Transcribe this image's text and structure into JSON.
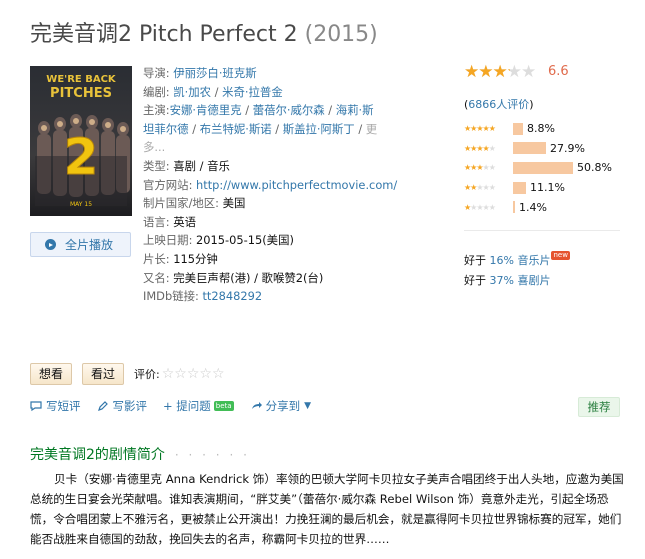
{
  "movie": {
    "title": "完美音调2 Pitch Perfect 2",
    "year": "(2015)"
  },
  "poster": {
    "tagline": "WE'RE BACK PITCHES",
    "number": "2",
    "date": "MAY 15"
  },
  "play_button_label": "全片播放",
  "info": {
    "director_label": "导演:",
    "director": "伊丽莎白·班克斯",
    "writers_label": "编剧:",
    "writer1": "凯·加农",
    "writer2": "米奇·拉普金",
    "cast_label": "主演:",
    "cast": [
      "安娜·肯德里克",
      "蕾蓓尔·威尔森",
      "海莉·斯坦菲尔德",
      "布兰特妮·斯诺",
      "斯盖拉·阿斯丁"
    ],
    "more": "更多...",
    "genre_label": "类型:",
    "genre": "喜剧 / 音乐",
    "site_label": "官方网站:",
    "site": "http://www.pitchperfectmovie.com/",
    "country_label": "制片国家/地区:",
    "country": "美国",
    "language_label": "语言:",
    "language": "英语",
    "release_label": "上映日期:",
    "release": "2015-05-15(美国)",
    "runtime_label": "片长:",
    "runtime": "115分钟",
    "aka_label": "又名:",
    "aka": "完美巨声帮(港) / 歌喉赞2(台)",
    "imdb_label": "IMDb链接:",
    "imdb": "tt2848292"
  },
  "rating": {
    "score": "6.6",
    "stars_fill": 0.65,
    "votes_prefix": "(",
    "votes_link": "6866人评价",
    "votes_suffix": ")",
    "breakdown": [
      {
        "stars": 5,
        "percent": 8.8,
        "label": "8.8%"
      },
      {
        "stars": 4,
        "percent": 27.9,
        "label": "27.9%"
      },
      {
        "stars": 3,
        "percent": 50.8,
        "label": "50.8%"
      },
      {
        "stars": 2,
        "percent": 11.1,
        "label": "11.1%"
      },
      {
        "stars": 1,
        "percent": 1.4,
        "label": "1.4%"
      }
    ],
    "colors": {
      "star": "#f5a623",
      "bar": "#f7c8a0",
      "score": "#e06b4c"
    }
  },
  "better_than": [
    {
      "prefix": "好于 ",
      "link": "16% 音乐片",
      "badge": "new"
    },
    {
      "prefix": "好于 ",
      "link": "37% 喜剧片"
    }
  ],
  "actions": {
    "want": "想看",
    "seen": "看过",
    "rate_label": "评价:"
  },
  "toolbar": {
    "short_review": "写短评",
    "review": "写影评",
    "ask": "+ 提问题",
    "beta": "beta",
    "share": "分享到",
    "recommend": "推荐"
  },
  "synopsis": {
    "title": "完美音调2的剧情简介",
    "dots": "· · · · · ·",
    "text": "贝卡（安娜·肯德里克 Anna Kendrick 饰）率领的巴顿大学阿卡贝拉女子美声合唱团终于出人头地，应邀为美国总统的生日宴会光荣献唱。谁知表演期间，“胖艾美”（蕾蓓尔·威尔森 Rebel Wilson 饰）竟意外走光，引起全场恐慌，令合唱团蒙上不雅污名，更被禁止公开演出！力挽狂澜的最后机会，就是赢得阿卡贝拉世界锦标赛的冠军，她们能否战胜来自德国的劲敌，挽回失去的名声，称霸阿卡贝拉的世界……"
  }
}
